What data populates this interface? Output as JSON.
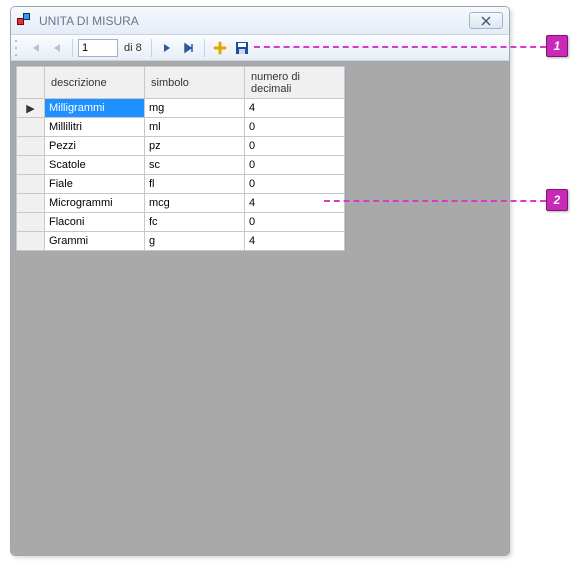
{
  "window": {
    "title": "UNITA DI MISURA"
  },
  "nav": {
    "position": "1",
    "of_label": "di 8"
  },
  "grid": {
    "columns": {
      "descrizione": "descrizione",
      "simbolo": "simbolo",
      "decimali": "numero di\ndecimali"
    },
    "rows": [
      {
        "descrizione": "Milligrammi",
        "simbolo": "mg",
        "decimali": "4",
        "selected": true,
        "current": true
      },
      {
        "descrizione": "Millilitri",
        "simbolo": "ml",
        "decimali": "0"
      },
      {
        "descrizione": "Pezzi",
        "simbolo": "pz",
        "decimali": "0"
      },
      {
        "descrizione": "Scatole",
        "simbolo": "sc",
        "decimali": "0"
      },
      {
        "descrizione": "Fiale",
        "simbolo": "fl",
        "decimali": "0"
      },
      {
        "descrizione": "Microgrammi",
        "simbolo": "mcg",
        "decimali": "4"
      },
      {
        "descrizione": "Flaconi",
        "simbolo": "fc",
        "decimali": "0"
      },
      {
        "descrizione": "Grammi",
        "simbolo": "g",
        "decimali": "4"
      }
    ]
  },
  "callouts": {
    "c1": "1",
    "c2": "2"
  }
}
